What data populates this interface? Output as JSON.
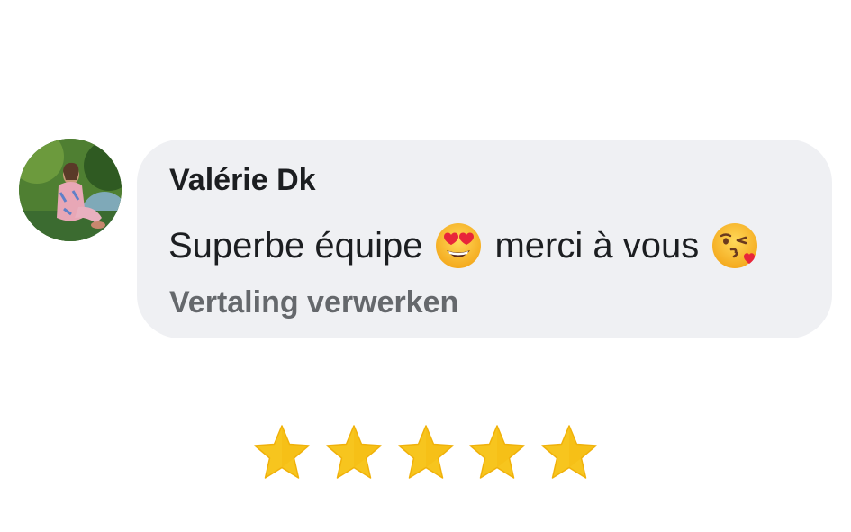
{
  "comment": {
    "author": "Valérie Dk",
    "text_part1": "Superbe équipe",
    "emoji1": "heart-eyes-emoji",
    "text_part2": "merci à vous",
    "emoji2": "kissing-heart-emoji",
    "translate_link": "Vertaling verwerken"
  },
  "rating": {
    "stars": 5,
    "max": 5,
    "star_color": "#f7c51e"
  },
  "colors": {
    "bubble_background": "#eff0f3",
    "text_primary": "#1c1e21",
    "text_secondary": "#65686c"
  }
}
